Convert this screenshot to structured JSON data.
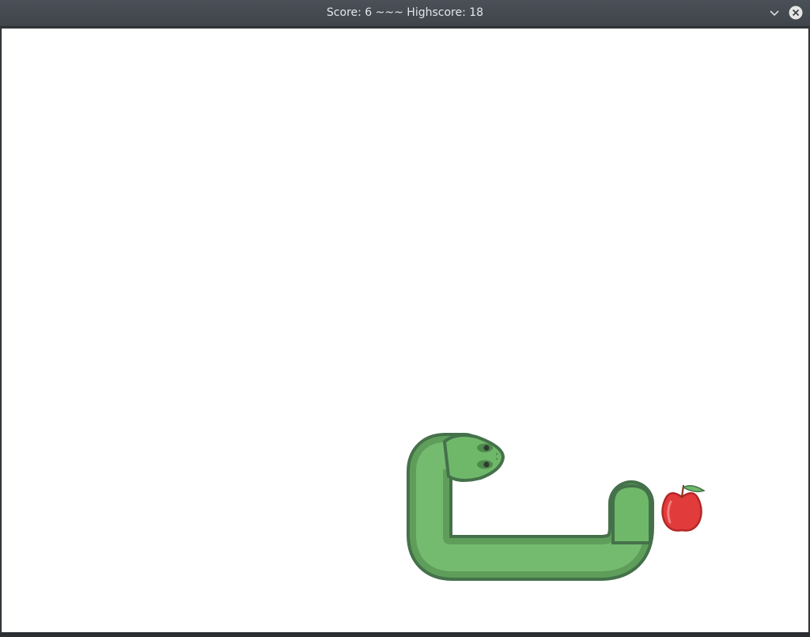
{
  "window": {
    "title": "Score: 6 ~~~ Highscore: 18"
  },
  "game": {
    "score": 6,
    "highscore": 18,
    "snake_length": 6,
    "snake_direction": "up",
    "apple_color": "#e23b3b",
    "snake_color": "#6fb86a",
    "snake_outline_color": "#45714a",
    "background_color": "#ffffff"
  },
  "icons": {
    "minimize": "chevron-down-icon",
    "close": "close-icon"
  }
}
